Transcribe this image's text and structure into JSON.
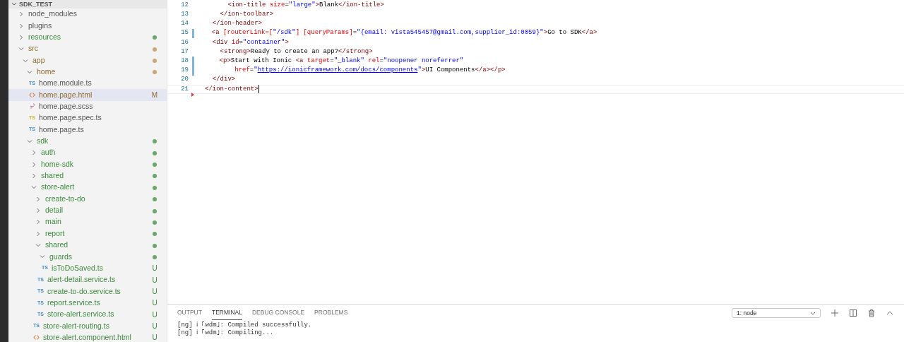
{
  "explorer": {
    "title": "SDK_TEST",
    "expanded": true,
    "items": [
      {
        "name": "node_modules",
        "kind": "folder",
        "expanded": false,
        "untracked": false,
        "modified": false,
        "selected": false
      },
      {
        "name": "plugins",
        "kind": "folder",
        "expanded": false,
        "untracked": false,
        "modified": false,
        "selected": false
      },
      {
        "name": "resources",
        "kind": "folder",
        "expanded": false,
        "untracked": true,
        "modified": false,
        "color": "#6aa56a",
        "selected": false
      },
      {
        "name": "src",
        "kind": "folder",
        "expanded": true,
        "untracked": false,
        "modified": true,
        "color": "#c8a978",
        "selected": false,
        "children": [
          {
            "name": "app",
            "kind": "folder",
            "expanded": true,
            "untracked": false,
            "modified": true,
            "color": "#c8a978",
            "selected": false,
            "children": [
              {
                "name": "home",
                "kind": "folder",
                "expanded": true,
                "untracked": false,
                "modified": true,
                "color": "#c8a978",
                "selected": false,
                "children": [
                  {
                    "name": "home.module.ts",
                    "kind": "ts",
                    "badge": "TS",
                    "untracked": false,
                    "modified": false,
                    "selected": false
                  },
                  {
                    "name": "home.page.html",
                    "kind": "html",
                    "untracked": false,
                    "modified": true,
                    "status": "M",
                    "selected": true
                  },
                  {
                    "name": "home.page.scss",
                    "kind": "scss",
                    "untracked": false,
                    "modified": false,
                    "selected": false
                  },
                  {
                    "name": "home.page.spec.ts",
                    "kind": "spec",
                    "badge": "TS",
                    "untracked": false,
                    "modified": false,
                    "selected": false
                  },
                  {
                    "name": "home.page.ts",
                    "kind": "ts",
                    "badge": "TS",
                    "untracked": false,
                    "modified": false,
                    "selected": false
                  }
                ]
              },
              {
                "name": "sdk",
                "kind": "folder",
                "expanded": true,
                "untracked": true,
                "modified": false,
                "color": "#6aa56a",
                "selected": false,
                "children": [
                  {
                    "name": "auth",
                    "kind": "folder",
                    "expanded": false,
                    "untracked": true,
                    "modified": false,
                    "color": "#6aa56a",
                    "selected": false
                  },
                  {
                    "name": "home-sdk",
                    "kind": "folder",
                    "expanded": false,
                    "untracked": true,
                    "modified": false,
                    "color": "#6aa56a",
                    "selected": false
                  },
                  {
                    "name": "shared",
                    "kind": "folder",
                    "expanded": false,
                    "untracked": true,
                    "modified": false,
                    "color": "#6aa56a",
                    "selected": false
                  },
                  {
                    "name": "store-alert",
                    "kind": "folder",
                    "expanded": true,
                    "untracked": true,
                    "modified": false,
                    "color": "#6aa56a",
                    "selected": false,
                    "children": [
                      {
                        "name": "create-to-do",
                        "kind": "folder",
                        "expanded": false,
                        "untracked": true,
                        "modified": false,
                        "color": "#6aa56a",
                        "selected": false
                      },
                      {
                        "name": "detail",
                        "kind": "folder",
                        "expanded": false,
                        "untracked": true,
                        "modified": false,
                        "color": "#6aa56a",
                        "selected": false
                      },
                      {
                        "name": "main",
                        "kind": "folder",
                        "expanded": false,
                        "untracked": true,
                        "modified": false,
                        "color": "#6aa56a",
                        "selected": false
                      },
                      {
                        "name": "report",
                        "kind": "folder",
                        "expanded": false,
                        "untracked": true,
                        "modified": false,
                        "color": "#6aa56a",
                        "selected": false
                      },
                      {
                        "name": "shared",
                        "kind": "folder",
                        "expanded": true,
                        "untracked": true,
                        "modified": false,
                        "color": "#6aa56a",
                        "selected": false,
                        "children": [
                          {
                            "name": "guards",
                            "kind": "folder",
                            "expanded": true,
                            "untracked": true,
                            "modified": false,
                            "color": "#6aa56a",
                            "selected": false,
                            "children": [
                              {
                                "name": "isToDoSaved.ts",
                                "kind": "ts",
                                "badge": "TS",
                                "untracked": true,
                                "modified": false,
                                "status": "U",
                                "selected": false
                              }
                            ]
                          },
                          {
                            "name": "alert-detail.service.ts",
                            "kind": "ts",
                            "badge": "TS",
                            "untracked": true,
                            "modified": false,
                            "status": "U",
                            "selected": false
                          },
                          {
                            "name": "create-to-do.service.ts",
                            "kind": "ts",
                            "badge": "TS",
                            "untracked": true,
                            "modified": false,
                            "status": "U",
                            "selected": false
                          },
                          {
                            "name": "report.service.ts",
                            "kind": "ts",
                            "badge": "TS",
                            "untracked": true,
                            "modified": false,
                            "status": "U",
                            "selected": false
                          },
                          {
                            "name": "store-alert.service.ts",
                            "kind": "ts",
                            "badge": "TS",
                            "untracked": true,
                            "modified": false,
                            "status": "U",
                            "selected": false
                          }
                        ]
                      },
                      {
                        "name": "store-alert-routing.ts",
                        "kind": "ts",
                        "badge": "TS",
                        "untracked": true,
                        "modified": false,
                        "status": "U",
                        "selected": false
                      },
                      {
                        "name": "store-alert.component.html",
                        "kind": "html",
                        "untracked": true,
                        "modified": false,
                        "status": "U",
                        "selected": false
                      }
                    ]
                  }
                ]
              }
            ]
          }
        ]
      }
    ]
  },
  "editor": {
    "lines": [
      {
        "number": "12",
        "changed": false,
        "cursor": false,
        "tokens": [
          {
            "kind": "tag",
            "text": "      <ion-title"
          },
          {
            "kind": "attr",
            "text": " size"
          },
          {
            "kind": "plain",
            "text": "="
          },
          {
            "kind": "value",
            "text": "\"large\""
          },
          {
            "kind": "tag",
            "text": ">"
          },
          {
            "kind": "plain",
            "text": "Blank"
          },
          {
            "kind": "tag",
            "text": "</ion-title>"
          }
        ]
      },
      {
        "number": "13",
        "changed": false,
        "cursor": false,
        "tokens": [
          {
            "kind": "tag",
            "text": "    </ion-toolbar>"
          }
        ]
      },
      {
        "number": "14",
        "changed": false,
        "cursor": false,
        "tokens": [
          {
            "kind": "tag",
            "text": "  </ion-header>"
          }
        ]
      },
      {
        "number": "15",
        "changed": true,
        "cursor": false,
        "tokens": [
          {
            "kind": "tag",
            "text": "  <a"
          },
          {
            "kind": "attr",
            "text": " [routerLink=["
          },
          {
            "kind": "value",
            "text": "\"/sdk\""
          },
          {
            "kind": "attr",
            "text": "]"
          },
          {
            "kind": "attr",
            "text": " [queryParams]"
          },
          {
            "kind": "plain",
            "text": "="
          },
          {
            "kind": "value",
            "text": "\"{email: vista545457@gmail.com,supplier_id:0059}\""
          },
          {
            "kind": "tag",
            "text": ">"
          },
          {
            "kind": "plain",
            "text": "Go to SDK"
          },
          {
            "kind": "tag",
            "text": "</a>"
          }
        ]
      },
      {
        "number": "16",
        "changed": false,
        "cursor": false,
        "tokens": [
          {
            "kind": "tag",
            "text": "  <div"
          },
          {
            "kind": "attr",
            "text": " id"
          },
          {
            "kind": "plain",
            "text": "="
          },
          {
            "kind": "value",
            "text": "\"container\""
          },
          {
            "kind": "tag",
            "text": ">"
          }
        ]
      },
      {
        "number": "17",
        "changed": false,
        "cursor": false,
        "tokens": [
          {
            "kind": "tag",
            "text": "    <strong>"
          },
          {
            "kind": "plain",
            "text": "Ready to create an app?"
          },
          {
            "kind": "tag",
            "text": "</strong>"
          }
        ]
      },
      {
        "number": "18",
        "changed": true,
        "cursor": false,
        "tokens": [
          {
            "kind": "tag",
            "text": "    <p>"
          },
          {
            "kind": "plain",
            "text": "Start with Ionic "
          },
          {
            "kind": "tag",
            "text": "<a"
          },
          {
            "kind": "attr",
            "text": " target"
          },
          {
            "kind": "plain",
            "text": "="
          },
          {
            "kind": "value",
            "text": "\"_blank\""
          },
          {
            "kind": "attr",
            "text": " rel"
          },
          {
            "kind": "plain",
            "text": "="
          },
          {
            "kind": "value",
            "text": "\"noopener noreferrer\""
          }
        ]
      },
      {
        "number": "19",
        "changed": true,
        "cursor": false,
        "tokens": [
          {
            "kind": "attr",
            "text": "        href"
          },
          {
            "kind": "plain",
            "text": "="
          },
          {
            "kind": "value",
            "text": "\""
          },
          {
            "kind": "link",
            "text": "https://ionicframework.com/docs/components"
          },
          {
            "kind": "value",
            "text": "\""
          },
          {
            "kind": "tag",
            "text": ">"
          },
          {
            "kind": "plain",
            "text": "UI Components"
          },
          {
            "kind": "tag",
            "text": "</a></p>"
          }
        ]
      },
      {
        "number": "20",
        "changed": false,
        "cursor": false,
        "tokens": [
          {
            "kind": "tag",
            "text": "  </div>"
          }
        ]
      },
      {
        "number": "21",
        "changed": false,
        "cursor": true,
        "deleted_below": true,
        "tokens": [
          {
            "kind": "tag",
            "text": "</ion-content>"
          }
        ]
      }
    ]
  },
  "panel": {
    "tabs": [
      {
        "label": "OUTPUT",
        "selected": false
      },
      {
        "label": "TERMINAL",
        "selected": true
      },
      {
        "label": "DEBUG CONSOLE",
        "selected": false
      },
      {
        "label": "PROBLEMS",
        "selected": false
      }
    ],
    "terminal_select": {
      "value": "1: node"
    },
    "terminal_lines": [
      "[ng] ℹ ｢wdm｣: Compiled successfully.",
      "[ng] ℹ ｢wdm｣: Compiling..."
    ]
  }
}
